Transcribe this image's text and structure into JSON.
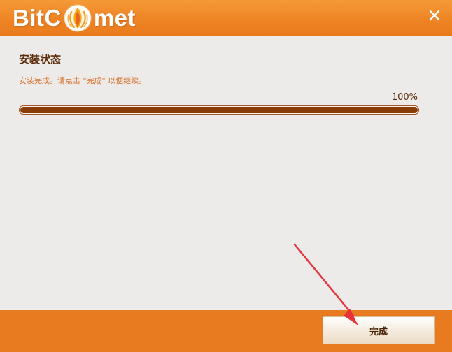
{
  "header": {
    "logo_prefix": "BitC",
    "logo_suffix": "met",
    "close_icon": "close-icon",
    "logo_icon": "comet-flame-icon"
  },
  "install": {
    "title": "安装状态",
    "message": "安装完成。请点击 \"完成\" 以便继续。",
    "progress_label": "100%",
    "progress_value": 100
  },
  "footer": {
    "finish_label": "完成"
  },
  "colors": {
    "header": "#ee8424",
    "footer": "#e87b1f",
    "progress_fill": "#8a3c07",
    "accent_text": "#d8702a",
    "title_text": "#5a2c0a",
    "annotation_arrow": "#e8323c"
  }
}
